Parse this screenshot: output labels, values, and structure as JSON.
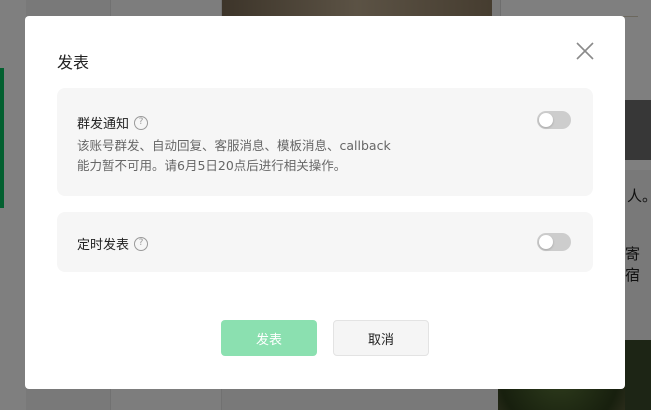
{
  "dialog": {
    "title": "发表",
    "close_icon": "close-icon",
    "options": [
      {
        "label": "群发通知",
        "help": "?",
        "description": "该账号群发、自动回复、客服消息、模板消息、callback能力暂不可用。请6月5日20点后进行相关操作。",
        "enabled": false
      },
      {
        "label": "定时发表",
        "help": "?",
        "enabled": false
      }
    ],
    "publish_label": "发表",
    "cancel_label": "取消"
  },
  "background": {
    "right_text_1": "人。",
    "right_text_2": "寄宿"
  },
  "colors": {
    "primary_disabled": "#8be0b0",
    "toggle_off": "#cdcdcd",
    "accent": "#07c160"
  }
}
